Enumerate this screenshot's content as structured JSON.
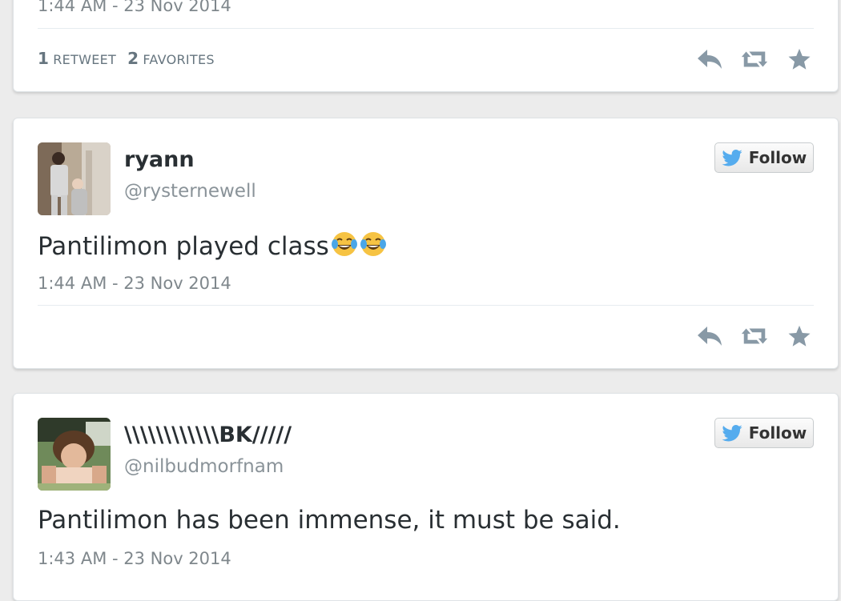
{
  "tweets": [
    {
      "timestamp": "1:44 AM - 23 Nov 2014",
      "stats": {
        "retweets_count": "1",
        "retweets_label": "Retweet",
        "favorites_count": "2",
        "favorites_label": "Favorites"
      }
    },
    {
      "name": "ryann",
      "handle": "@rysternewell",
      "text": "Pantilimon played class",
      "emojis": [
        "face-with-tears-of-joy",
        "face-with-tears-of-joy"
      ],
      "timestamp": "1:44 AM - 23 Nov 2014",
      "follow_label": "Follow"
    },
    {
      "name": "\\\\\\\\\\\\\\\\\\\\\\\\BK/////",
      "handle": "@nilbudmorfnam",
      "text": "Pantilimon has been immense, it must be said.",
      "timestamp": "1:43 AM - 23 Nov 2014",
      "follow_label": "Follow"
    }
  ],
  "icons": {
    "reply": "reply-icon",
    "retweet": "retweet-icon",
    "favorite": "star-icon",
    "bird": "twitter-bird-icon"
  },
  "colors": {
    "background": "#ececec",
    "card": "#ffffff",
    "icon_gray": "#8899a6",
    "twitter_blue": "#55acee",
    "text": "#292f33",
    "muted": "#7f878c"
  }
}
